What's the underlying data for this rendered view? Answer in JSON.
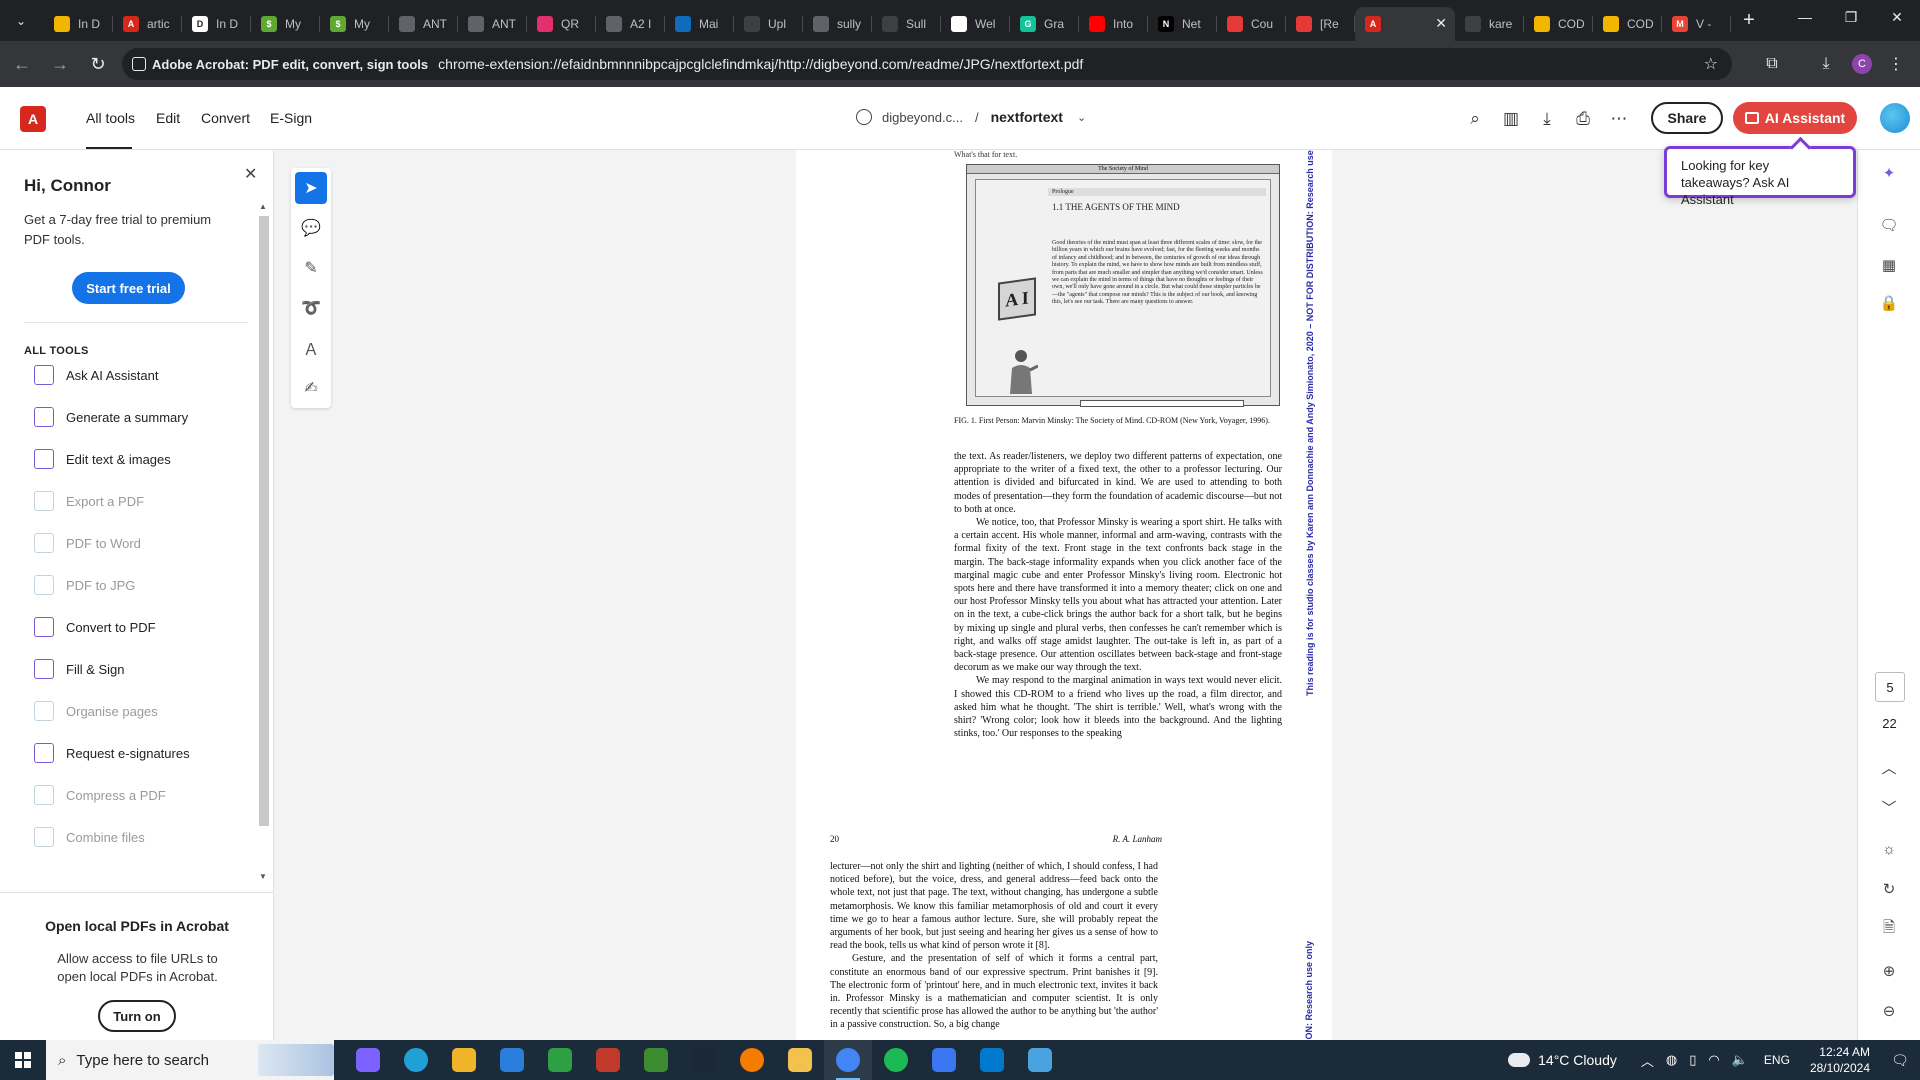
{
  "browser": {
    "tabs": [
      {
        "title": "In D",
        "color": "#f2b600",
        "glyph": ""
      },
      {
        "title": "artic",
        "color": "#d7281e",
        "glyph": "A"
      },
      {
        "title": "In D",
        "color": "#ffffff",
        "glyph": "D"
      },
      {
        "title": "My",
        "color": "#5fa832",
        "glyph": "$"
      },
      {
        "title": "My",
        "color": "#5fa832",
        "glyph": "$"
      },
      {
        "title": "ANT",
        "color": "#5f6368",
        "glyph": ""
      },
      {
        "title": "ANT",
        "color": "#5f6368",
        "glyph": ""
      },
      {
        "title": "QR",
        "color": "#e1306c",
        "glyph": ""
      },
      {
        "title": "A2 I",
        "color": "#5f6368",
        "glyph": ""
      },
      {
        "title": "Mai",
        "color": "#0f6cbd",
        "glyph": ""
      },
      {
        "title": "Upl",
        "color": "#3c4043",
        "glyph": ""
      },
      {
        "title": "sully",
        "color": "#5f6368",
        "glyph": ""
      },
      {
        "title": "Sull",
        "color": "#3c4043",
        "glyph": ""
      },
      {
        "title": "Wel",
        "color": "#ffffff",
        "glyph": ""
      },
      {
        "title": "Gra",
        "color": "#15c39a",
        "glyph": "G"
      },
      {
        "title": "Into",
        "color": "#ff0000",
        "glyph": ""
      },
      {
        "title": "Net",
        "color": "#000000",
        "glyph": "N"
      },
      {
        "title": "Cou",
        "color": "#e53935",
        "glyph": ""
      },
      {
        "title": "[Re",
        "color": "#e53935",
        "glyph": ""
      },
      {
        "title": "",
        "color": "#d7281e",
        "glyph": "A",
        "active": true
      },
      {
        "title": "kare",
        "color": "#3c4043",
        "glyph": ""
      },
      {
        "title": "COD",
        "color": "#f2b600",
        "glyph": ""
      },
      {
        "title": "COD",
        "color": "#f2b600",
        "glyph": ""
      },
      {
        "title": "V -",
        "color": "#ea4335",
        "glyph": "M"
      }
    ],
    "new_tab": "+",
    "window_controls": {
      "minimize": "—",
      "restore": "❐",
      "close": "✕"
    },
    "site_chip": "Adobe Acrobat: PDF edit, convert, sign tools",
    "url": "chrome-extension://efaidnbmnnnibpcajpcglclefindmkaj/http://digbeyond.com/readme/JPG/nextfortext.pdf",
    "profile_initial": "C"
  },
  "acrobat": {
    "menu": [
      "All tools",
      "Edit",
      "Convert",
      "E-Sign"
    ],
    "breadcrumb_site": "digbeyond.c...",
    "breadcrumb_sep": "/",
    "doc_name": "nextfortext",
    "share": "Share",
    "ai_assistant": "AI Assistant",
    "tooltip": "Looking for key takeaways? Ask AI Assistant"
  },
  "left_panel": {
    "greeting": "Hi, Connor",
    "promo": "Get a 7-day free trial to premium PDF tools.",
    "trial_button": "Start free trial",
    "all_tools_header": "ALL TOOLS",
    "tools": [
      {
        "label": "Ask AI Assistant",
        "enabled": true
      },
      {
        "label": "Generate a summary",
        "enabled": true
      },
      {
        "label": "Edit text & images",
        "enabled": true
      },
      {
        "label": "Export a PDF",
        "enabled": false
      },
      {
        "label": "PDF to Word",
        "enabled": false
      },
      {
        "label": "PDF to JPG",
        "enabled": false
      },
      {
        "label": "Convert to PDF",
        "enabled": true
      },
      {
        "label": "Fill & Sign",
        "enabled": true
      },
      {
        "label": "Organise pages",
        "enabled": false
      },
      {
        "label": "Request e-signatures",
        "enabled": true
      },
      {
        "label": "Compress a PDF",
        "enabled": false
      },
      {
        "label": "Combine files",
        "enabled": false
      }
    ],
    "local_title": "Open local PDFs in Acrobat",
    "local_desc": "Allow access to file URLs to open local PDFs in Acrobat.",
    "turn_on": "Turn on"
  },
  "document": {
    "page1": {
      "cut_top_text": "What's that for text.",
      "figure": {
        "window_title": "The Society of Mind",
        "prologue": "Prologue",
        "heading": "1.1  THE AGENTS OF THE MIND",
        "body": "Good theories of the mind must span at least three different scales of time: slow, for the billion years in which our brains have evolved; fast, for the fleeting weeks and months of infancy and childhood; and in between, the centuries of growth of our ideas through history. To explain the mind, we have to show how minds are built from mindless stuff, from parts that are much smaller and simpler than anything we'd consider smart. Unless we can explain the mind in terms of things that have no thoughts or feelings of their own, we'll only have gone around in a circle. But what could those simpler particles be—the \"agents\" that compose our minds? This is the subject of our book, and knowing this, let's see our task. There are many questions to answer.",
        "cube_letters": "A I"
      },
      "caption": "FIG. 1. First Person: Marvin Minsky: The Society of Mind. CD-ROM (New York, Voyager, 1996).",
      "paragraphs": [
        "the text. As reader/listeners, we deploy two different patterns of expectation, one appropriate to the writer of a fixed text, the other to a professor lecturing. Our attention is divided and bifurcated in kind. We are used to attending to both modes of presentation—they form the foundation of academic discourse—but not to both at once.",
        "We notice, too, that Professor Minsky is wearing a sport shirt. He talks with a certain accent. His whole manner, informal and arm-waving, contrasts with the formal fixity of the text. Front stage in the text confronts back stage in the margin. The back-stage informality expands when you click another face of the marginal magic cube and enter Professor Minsky's living room. Electronic hot spots here and there have transformed it into a memory theater; click on one and our host Professor Minsky tells you about what has attracted your attention. Later on in the text, a cube-click brings the author back for a short talk, but he begins by mixing up single and plural verbs, then confesses he can't remember which is right, and walks off stage amidst laughter. The out-take is left in, as part of a back-stage presence. Our attention oscillates between back-stage and front-stage decorum as we make our way through the text.",
        "We may respond to the marginal animation in ways text would never elicit. I showed this CD-ROM to a friend who lives up the road, a film director, and asked him what he thought. 'The shirt is terrible.' Well, what's wrong with the shirt? 'Wrong color; look how it bleeds into the background. And the lighting stinks, too.' Our responses to the speaking"
      ],
      "watermark": "This reading is for studio classes by Karen ann Donnachie and Andy Simionato, 2020 – NOT FOR DISTRIBUTION: Research use only"
    },
    "page2": {
      "page_number": "20",
      "author": "R. A. Lanham",
      "paragraphs": [
        "lecturer—not only the shirt and lighting (neither of which, I should confess, I had noticed before), but the voice, dress, and general address—feed back onto the whole text, not just that page. The text, without changing, has undergone a subtle metamorphosis. We know this familiar metamorphosis of old and court it every time we go to hear a famous author lecture. Sure, she will probably repeat the arguments of her book, but just seeing and hearing her gives us a sense of how to read the book, tells us what kind of person wrote it [8].",
        "Gesture, and the presentation of self of which it forms a central part, constitute an enormous band of our expressive spectrum. Print banishes it [9]. The electronic form of 'printout' here, and in much electronic text, invites it back in. Professor Minsky is a mathematician and computer scientist. It is only recently that scientific prose has allowed the author to be anything but 'the author' in a passive construction. So, a big change"
      ],
      "watermark": "UTION: Research use only"
    }
  },
  "page_nav": {
    "current": "5",
    "total": "22"
  },
  "taskbar": {
    "search_placeholder": "Type here to search",
    "weather": "14°C  Cloudy",
    "lang": "ENG",
    "time": "12:24 AM",
    "date": "28/10/2024",
    "pinned": [
      {
        "name": "copilot",
        "color": "#7b61ff"
      },
      {
        "name": "edge",
        "color": "#1fa1d8"
      },
      {
        "name": "store",
        "color": "#f0b429"
      },
      {
        "name": "mail",
        "color": "#2a7ddb"
      },
      {
        "name": "xbox",
        "color": "#2ea043"
      },
      {
        "name": "game-app",
        "color": "#c0392b"
      },
      {
        "name": "minecraft",
        "color": "#3c8d2f"
      },
      {
        "name": "steam",
        "color": "#1b2838"
      },
      {
        "name": "brave",
        "color": "#f57c00"
      },
      {
        "name": "file-explorer",
        "color": "#f2c14e"
      },
      {
        "name": "chrome",
        "color": "#4285f4",
        "active": true
      },
      {
        "name": "spotify",
        "color": "#1db954"
      },
      {
        "name": "signal",
        "color": "#3a76f0"
      },
      {
        "name": "vscode",
        "color": "#007acc"
      },
      {
        "name": "paint",
        "color": "#4aa3df"
      }
    ]
  }
}
